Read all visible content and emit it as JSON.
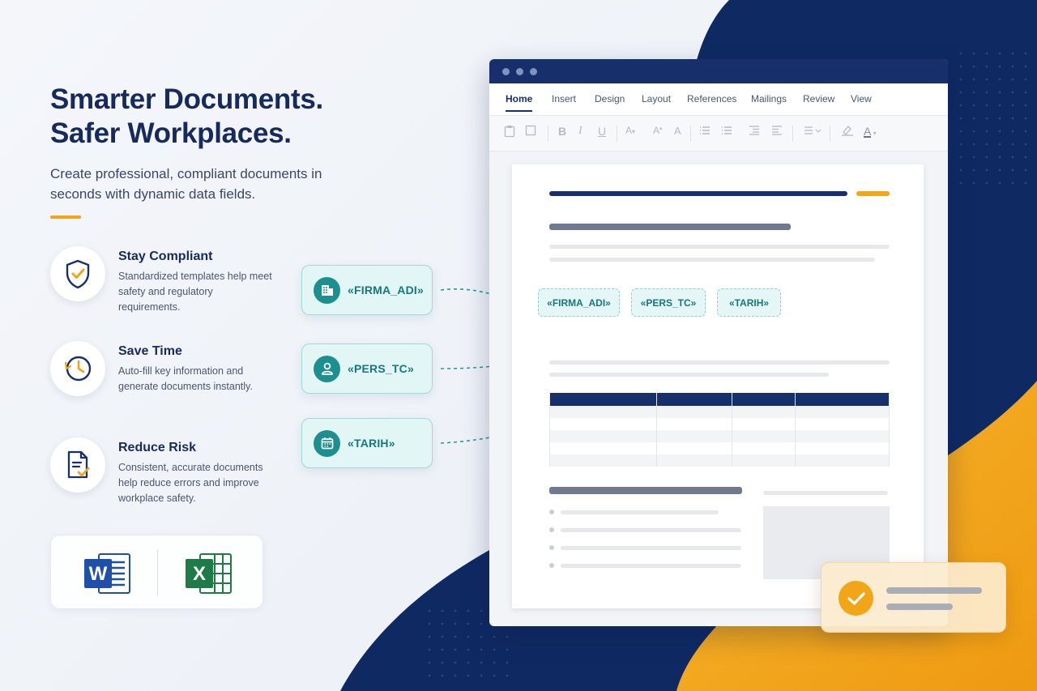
{
  "headline": {
    "line1": "Smarter Documents.",
    "line2": "Safer Workplaces."
  },
  "subtitle": "Create professional, compliant documents in seconds with dynamic data fields.",
  "features": [
    {
      "icon": "shield-check-icon",
      "title": "Stay Compliant",
      "description": "Standardized templates help meet safety and regulatory requirements."
    },
    {
      "icon": "clock-icon",
      "title": "Save Time",
      "description": "Auto-fill key information and generate documents instantly."
    },
    {
      "icon": "document-check-icon",
      "title": "Reduce Risk",
      "description": "Consistent, accurate documents help reduce errors and improve workplace safety."
    }
  ],
  "apps": [
    {
      "icon": "microsoft-word-icon",
      "letter": "W"
    },
    {
      "icon": "microsoft-excel-icon",
      "letter": "X"
    }
  ],
  "field_chips": [
    {
      "icon": "building-icon",
      "label": "«FIRMA_ADI»"
    },
    {
      "icon": "person-icon",
      "label": "«PERS_TC»"
    },
    {
      "icon": "calendar-icon",
      "label": "«TARIH»"
    }
  ],
  "editor": {
    "tabs": [
      "Home",
      "Insert",
      "Design",
      "Layout",
      "References",
      "Mailings",
      "Review",
      "View"
    ],
    "active_tab": "Home",
    "toolbar_glyphs": {
      "bold": "B",
      "italic": "I",
      "underline": "U",
      "font_size": "A",
      "grow_font": "A",
      "font_color": "A"
    },
    "merge_fields": [
      "«FIRMA_ADI»",
      "«PERS_TC»",
      "«TARIH»"
    ]
  },
  "colors": {
    "navy": "#17306b",
    "teal": "#1e8f8f",
    "accent_orange": "#f2a516"
  }
}
